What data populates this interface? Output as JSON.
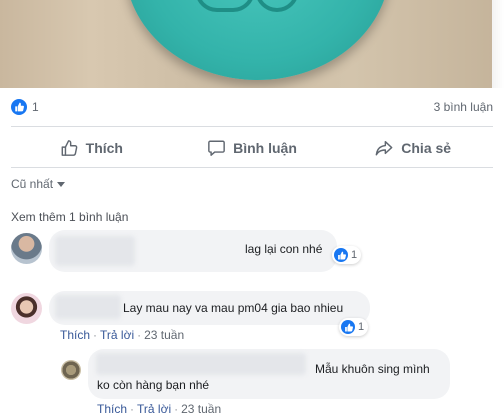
{
  "post": {
    "like_count": "1",
    "comment_count": "3 bình luận"
  },
  "actions": {
    "like": "Thích",
    "comment": "Bình luận",
    "share": "Chia sẻ"
  },
  "sort": {
    "label": "Cũ nhất"
  },
  "more_comments": "Xem thêm 1 bình luận",
  "comments": [
    {
      "text": "lag lại con nhé",
      "reactions": "1"
    },
    {
      "text": "Lay mau nay va mau pm04 gia bao nhieu",
      "reactions": "1",
      "like": "Thích",
      "reply": "Trả lời",
      "time": "23 tuần"
    }
  ],
  "reply": {
    "text_line1": "Mẫu khuôn sing mình",
    "text_line2": "ko còn hàng bạn nhé",
    "like": "Thích",
    "reply": "Trả lời",
    "time": "23 tuần"
  },
  "colors": {
    "accent": "#1877f2",
    "link": "#385898",
    "muted": "#606770"
  }
}
